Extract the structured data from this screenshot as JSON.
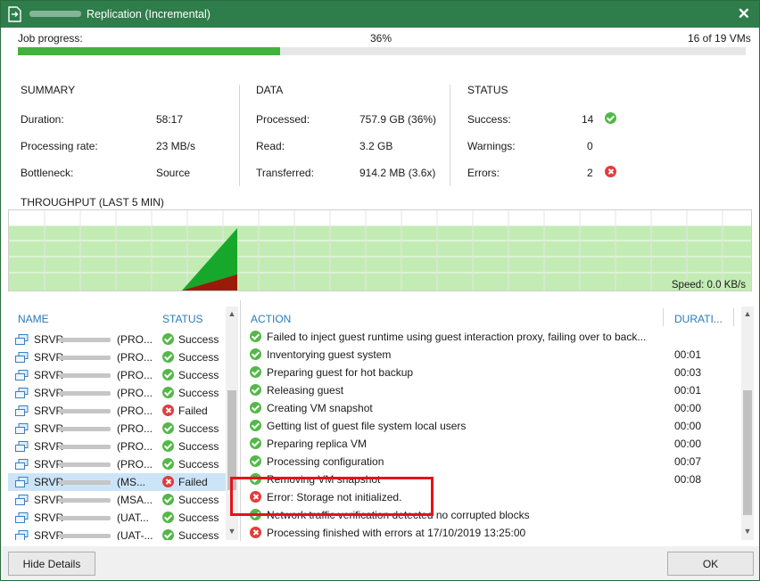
{
  "window": {
    "title": "Replication (Incremental)"
  },
  "progress": {
    "label": "Job progress:",
    "percent_text": "36%",
    "percent_value": 36,
    "vms_text": "16 of 19 VMs"
  },
  "summary": {
    "title": "SUMMARY",
    "duration_label": "Duration:",
    "duration_value": "58:17",
    "rate_label": "Processing rate:",
    "rate_value": "23 MB/s",
    "bottleneck_label": "Bottleneck:",
    "bottleneck_value": "Source"
  },
  "data": {
    "title": "DATA",
    "processed_label": "Processed:",
    "processed_value": "757.9 GB (36%)",
    "read_label": "Read:",
    "read_value": "3.2 GB",
    "transferred_label": "Transferred:",
    "transferred_value": "914.2 MB (3.6x)"
  },
  "status": {
    "title": "STATUS",
    "success_label": "Success:",
    "success_value": "14",
    "warnings_label": "Warnings:",
    "warnings_value": "0",
    "errors_label": "Errors:",
    "errors_value": "2"
  },
  "throughput": {
    "title": "THROUGHPUT (LAST 5 MIN)",
    "speed_text": "Speed: 0.0 KB/s"
  },
  "colors": {
    "accent": "#2e7d4a",
    "progress": "#41b23b",
    "success": "#53b847",
    "error": "#e23c3c",
    "header_blue": "#2a7ab8",
    "selected": "#cce4f7",
    "chart_bg": "#c3ecb4",
    "chart_green": "#17a82b",
    "chart_red": "#9b1b0b"
  },
  "vm_list": {
    "name_header": "NAME",
    "status_header": "STATUS",
    "rows": [
      {
        "name": "SRVR",
        "tag": "(PRO...",
        "status": "Success",
        "state": "ok",
        "selected": false
      },
      {
        "name": "SRVR",
        "tag": "(PRO...",
        "status": "Success",
        "state": "ok",
        "selected": false
      },
      {
        "name": "SRVR",
        "tag": "(PRO...",
        "status": "Success",
        "state": "ok",
        "selected": false
      },
      {
        "name": "SRVR",
        "tag": "(PRO...",
        "status": "Success",
        "state": "ok",
        "selected": false
      },
      {
        "name": "SRVR",
        "tag": "(PRO...",
        "status": "Failed",
        "state": "err",
        "selected": false
      },
      {
        "name": "SRVR",
        "tag": "(PRO...",
        "status": "Success",
        "state": "ok",
        "selected": false
      },
      {
        "name": "SRVR",
        "tag": "(PRO...",
        "status": "Success",
        "state": "ok",
        "selected": false
      },
      {
        "name": "SRVR",
        "tag": "(PRO...",
        "status": "Success",
        "state": "ok",
        "selected": false
      },
      {
        "name": "SRVR",
        "tag": "(MS...",
        "status": "Failed",
        "state": "err",
        "selected": true
      },
      {
        "name": "SRVR",
        "tag": "(MSA...",
        "status": "Success",
        "state": "ok",
        "selected": false
      },
      {
        "name": "SRVR",
        "tag": "(UAT...",
        "status": "Success",
        "state": "ok",
        "selected": false
      },
      {
        "name": "SRVR",
        "tag": "(UAT-...",
        "status": "Success",
        "state": "ok",
        "selected": false
      }
    ]
  },
  "actions": {
    "action_header": "ACTION",
    "duration_header": "DURATI...",
    "rows": [
      {
        "text": "Failed to inject guest runtime using guest interaction proxy, failing over to back...",
        "duration": "",
        "state": "ok"
      },
      {
        "text": "Inventorying guest system",
        "duration": "00:01",
        "state": "ok"
      },
      {
        "text": "Preparing guest for hot backup",
        "duration": "00:03",
        "state": "ok"
      },
      {
        "text": "Releasing guest",
        "duration": "00:01",
        "state": "ok"
      },
      {
        "text": "Creating VM snapshot",
        "duration": "00:00",
        "state": "ok"
      },
      {
        "text": "Getting list of guest file system local users",
        "duration": "00:00",
        "state": "ok"
      },
      {
        "text": "Preparing replica VM",
        "duration": "00:00",
        "state": "ok"
      },
      {
        "text": "Processing configuration",
        "duration": "00:07",
        "state": "ok"
      },
      {
        "text": "Removing VM snapshot",
        "duration": "00:08",
        "state": "ok"
      },
      {
        "text": "Error: Storage not initialized.",
        "duration": "",
        "state": "err"
      },
      {
        "text": "Network traffic verification detected no corrupted blocks",
        "duration": "",
        "state": "ok"
      },
      {
        "text": "Processing finished with errors at 17/10/2019 13:25:00",
        "duration": "",
        "state": "err"
      }
    ]
  },
  "buttons": {
    "hide_details": "Hide Details",
    "ok": "OK"
  }
}
